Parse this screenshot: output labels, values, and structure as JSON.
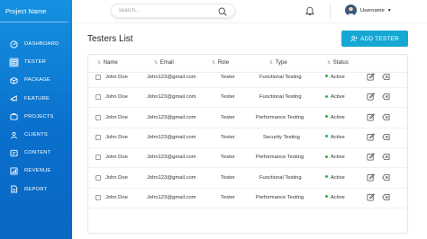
{
  "sidebar": {
    "brand": "Project Name",
    "items": [
      {
        "label": "DASHBOARD",
        "icon": "dashboard-icon"
      },
      {
        "label": "TESTER",
        "icon": "tester-icon",
        "active": true
      },
      {
        "label": "PACKAGE",
        "icon": "package-icon"
      },
      {
        "label": "FEATURE",
        "icon": "feature-icon"
      },
      {
        "label": "PROJECTS",
        "icon": "projects-icon"
      },
      {
        "label": "CLIENTS",
        "icon": "clients-icon"
      },
      {
        "label": "CONTENT",
        "icon": "content-icon"
      },
      {
        "label": "REVENUE",
        "icon": "revenue-icon"
      },
      {
        "label": "REPORT",
        "icon": "report-icon"
      }
    ]
  },
  "topbar": {
    "search_placeholder": "search...",
    "username": "Username"
  },
  "main": {
    "title": "Testers List",
    "add_button": "ADD TESTER",
    "columns": [
      "Name",
      "Email",
      "Role",
      "Type",
      "Status"
    ],
    "rows": [
      {
        "name": "John Doe",
        "email": "John123@gmail.com",
        "role": "Tester",
        "type": "Functional Testing",
        "status": "Active"
      },
      {
        "name": "John Doe",
        "email": "John123@gmail.com",
        "role": "Tester",
        "type": "Functional Testing",
        "status": "Active"
      },
      {
        "name": "John Doe",
        "email": "John123@gmail.com",
        "role": "Tester",
        "type": "Performance Testing",
        "status": "Active"
      },
      {
        "name": "John Doe",
        "email": "John123@gmail.com",
        "role": "Tester",
        "type": "Security Testing",
        "status": "Active"
      },
      {
        "name": "John Doe",
        "email": "John123@gmail.com",
        "role": "Tester",
        "type": "Performance Testing",
        "status": "Active"
      },
      {
        "name": "John Doe",
        "email": "John123@gmail.com",
        "role": "Tester",
        "type": "Functional Testing",
        "status": "Active"
      },
      {
        "name": "John Doe",
        "email": "John123@gmail.com",
        "role": "Tester",
        "type": "Performance Testing",
        "status": "Active"
      }
    ]
  },
  "colors": {
    "sidebar_top": "#1591e0",
    "sidebar_bottom": "#0868c2",
    "accent_button": "#16a8d4",
    "status_active": "#22b84c"
  }
}
